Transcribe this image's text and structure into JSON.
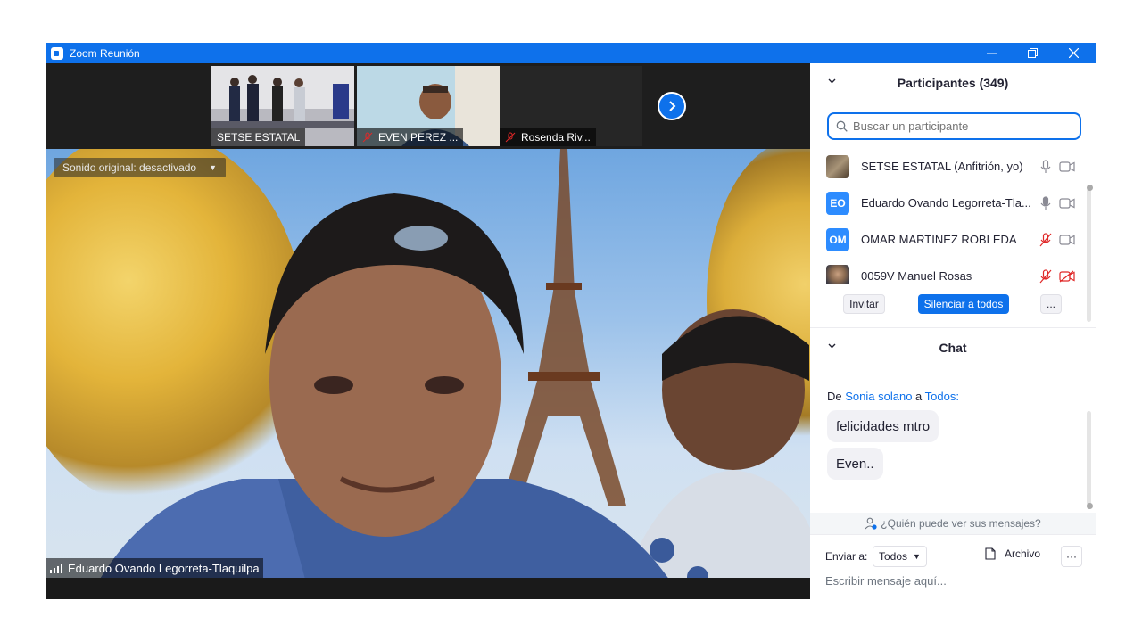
{
  "window": {
    "title": "Zoom Reunión",
    "colors": {
      "accent": "#0e71eb",
      "muted_red": "#e02828"
    }
  },
  "thumbnails": [
    {
      "name": "SETSE ESTATAL",
      "muted": false
    },
    {
      "name": "EVEN PEREZ ...",
      "muted": true
    },
    {
      "name": "Rosenda Riv...",
      "muted": true
    }
  ],
  "main_video": {
    "sound_label": "Sonido original: desactivado",
    "speaker_name": "Eduardo Ovando Legorreta-Tlaquilpa"
  },
  "participants": {
    "title": "Participantes (349)",
    "search_placeholder": "Buscar un participante",
    "items": [
      {
        "name": "SETSE ESTATAL (Anfitrión, yo)",
        "avatar": "photo",
        "avatar_color": "#7a6a58",
        "mic": "on",
        "cam": "on"
      },
      {
        "name": "Eduardo Ovando Legorreta-Tla...",
        "avatar": "EO",
        "avatar_color": "#2d8cff",
        "mic": "on",
        "cam": "on"
      },
      {
        "name": "OMAR MARTINEZ ROBLEDA",
        "avatar": "OM",
        "avatar_color": "#2d8cff",
        "mic": "muted",
        "cam": "on"
      },
      {
        "name": "0059V Manuel Rosas",
        "avatar": "photo",
        "avatar_color": "#8a7a6a",
        "mic": "muted",
        "cam": "off"
      }
    ],
    "buttons": {
      "invite": "Invitar",
      "mute_all": "Silenciar a todos",
      "more": "..."
    }
  },
  "chat": {
    "title": "Chat",
    "from_prefix": "De",
    "sender": "Sonia solano",
    "to_word": "a",
    "recipient": "Todos:",
    "messages": [
      "felicidades mtro",
      "Even.."
    ],
    "who_can_see": "¿Quién puede ver sus mensajes?",
    "send_to_label": "Enviar a:",
    "send_to_value": "Todos",
    "file_label": "Archivo",
    "more_label": "···",
    "input_placeholder": "Escribir mensaje aquí..."
  }
}
